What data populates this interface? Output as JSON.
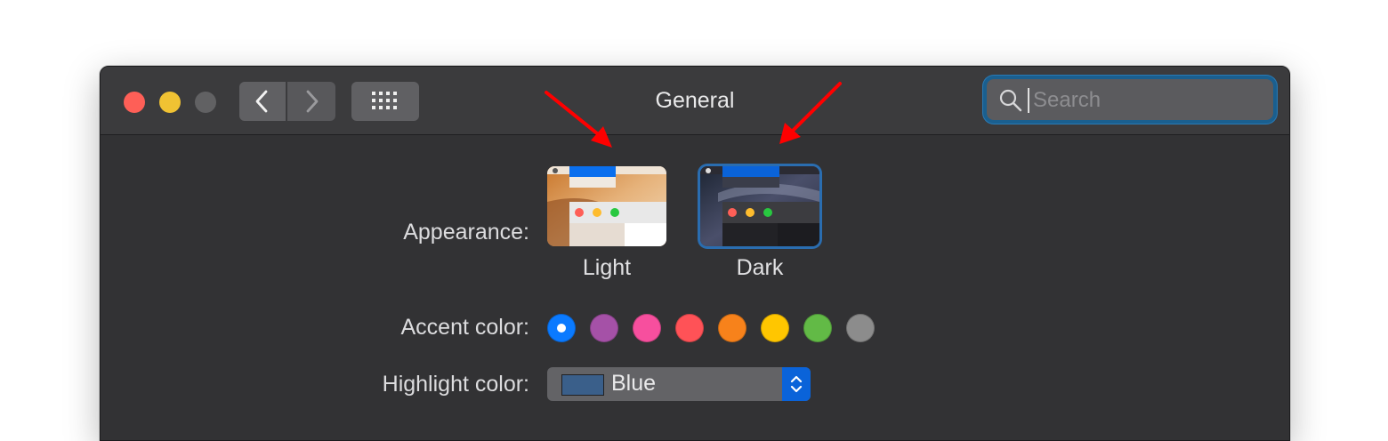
{
  "window": {
    "title": "General"
  },
  "titlebar": {
    "close": "close-button",
    "minimize": "minimize-button",
    "zoom": "zoom-button",
    "back": "back-chevron-icon",
    "forward": "forward-chevron-icon",
    "grid": "show-all-grid-icon"
  },
  "search": {
    "placeholder": "Search",
    "value": "",
    "icon": "magnifier-icon",
    "focused": true
  },
  "appearance": {
    "label": "Appearance:",
    "options": [
      {
        "label": "Light",
        "selected": false
      },
      {
        "label": "Dark",
        "selected": true
      }
    ]
  },
  "accent": {
    "label": "Accent color:",
    "colors": [
      {
        "name": "blue",
        "hex": "#0a7aff",
        "selected": true
      },
      {
        "name": "purple",
        "hex": "#a551a7"
      },
      {
        "name": "pink",
        "hex": "#f74f9e"
      },
      {
        "name": "red",
        "hex": "#ff5257"
      },
      {
        "name": "orange",
        "hex": "#f7821b"
      },
      {
        "name": "yellow",
        "hex": "#ffc600"
      },
      {
        "name": "green",
        "hex": "#62ba46"
      },
      {
        "name": "graphite",
        "hex": "#8c8c8c"
      }
    ]
  },
  "highlight": {
    "label": "Highlight color:",
    "value": "Blue",
    "chip_color": "#3a5f8a"
  },
  "annotations": {
    "arrow_color": "#ff0000"
  }
}
